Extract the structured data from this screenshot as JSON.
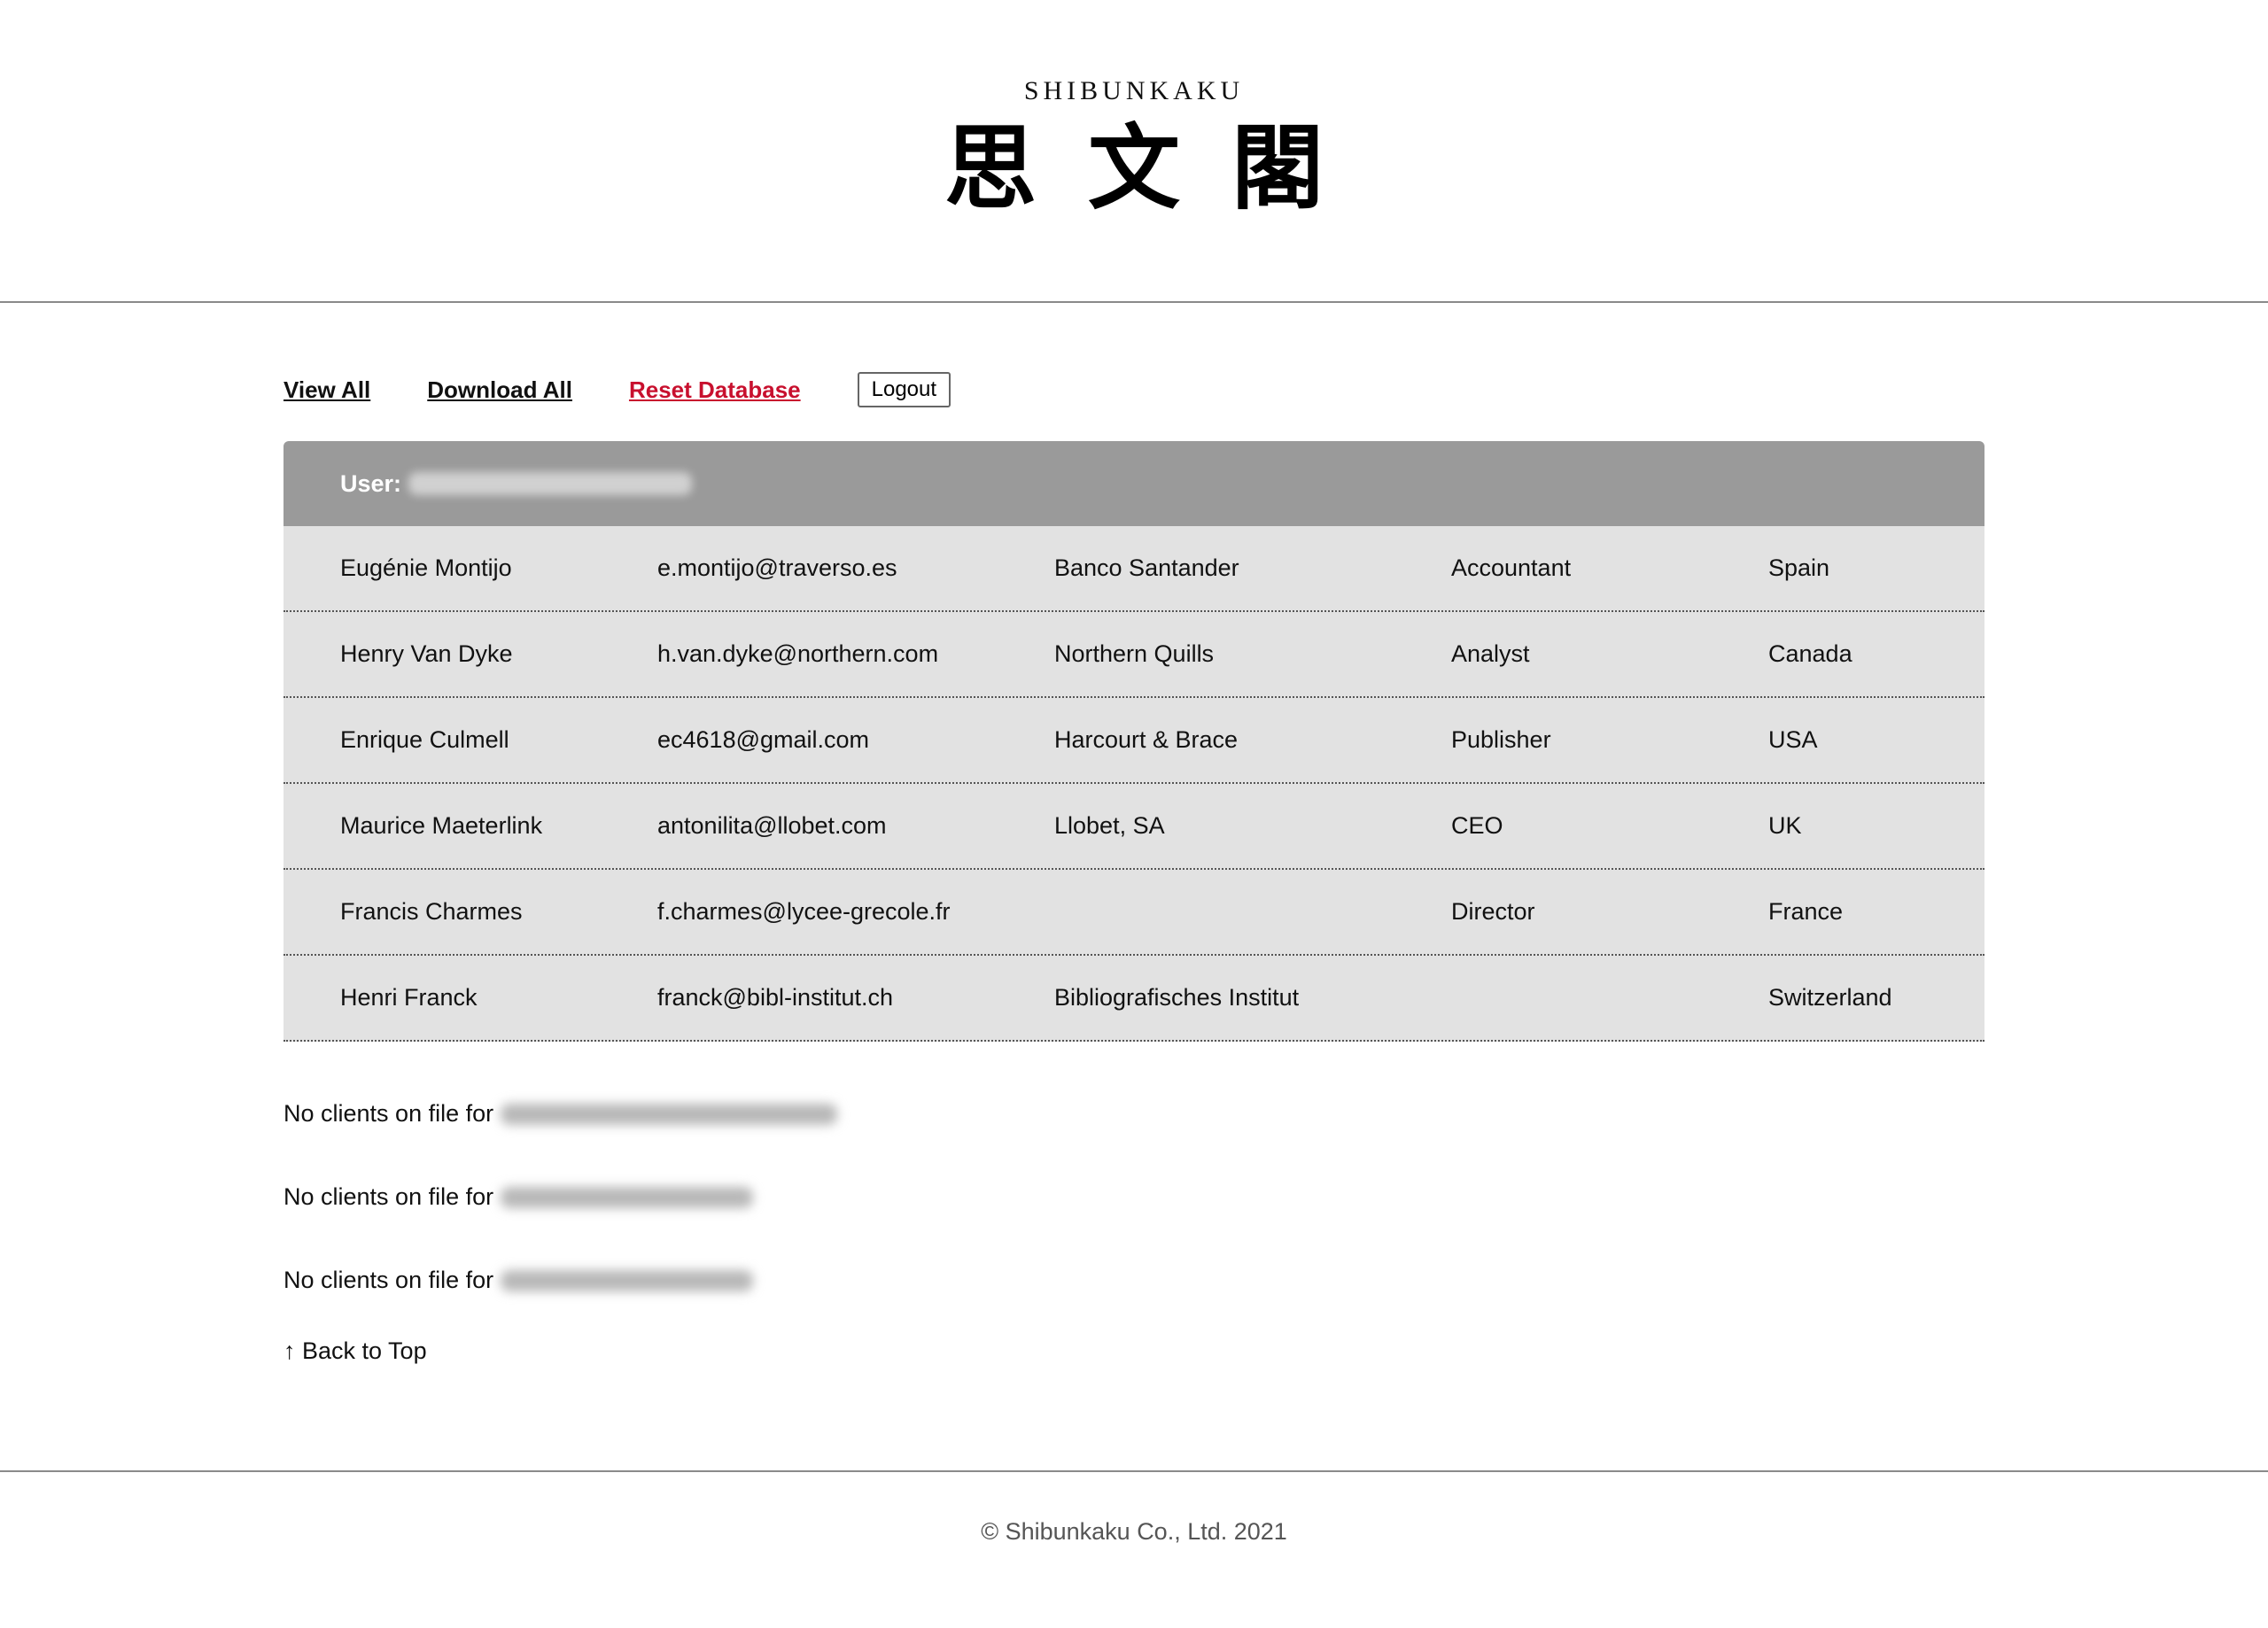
{
  "brand": {
    "latin": "SHIBUNKAKU",
    "kanji": "思文閣"
  },
  "toolbar": {
    "view_all": "View All",
    "download_all": "Download All",
    "reset_database": "Reset Database",
    "logout": "Logout",
    "reset_color": "#c8102e"
  },
  "user_panel": {
    "label": "User:",
    "clients": [
      {
        "name": "Eugénie Montijo",
        "email": "e.montijo@traverso.es",
        "company": "Banco Santander",
        "role": "Accountant",
        "country": "Spain"
      },
      {
        "name": "Henry Van Dyke",
        "email": "h.van.dyke@northern.com",
        "company": "Northern Quills",
        "role": "Analyst",
        "country": "Canada"
      },
      {
        "name": "Enrique Culmell",
        "email": "ec4618@gmail.com",
        "company": "Harcourt & Brace",
        "role": "Publisher",
        "country": "USA"
      },
      {
        "name": "Maurice Maeterlink",
        "email": "antonilita@llobet.com",
        "company": "Llobet, SA",
        "role": "CEO",
        "country": "UK"
      },
      {
        "name": "Francis Charmes",
        "email": "f.charmes@lycee-grecole.fr",
        "company": "",
        "role": "Director",
        "country": "France"
      },
      {
        "name": "Henri Franck",
        "email": "franck@bibl-institut.ch",
        "company": "Bibliografisches Institut",
        "role": "",
        "country": "Switzerland"
      }
    ]
  },
  "empty_notices": [
    "No clients on file for",
    "No clients on file for",
    "No clients on file for"
  ],
  "back_to_top": "↑ Back to Top",
  "footer": {
    "copyright": "© Shibunkaku Co., Ltd. 2021"
  }
}
